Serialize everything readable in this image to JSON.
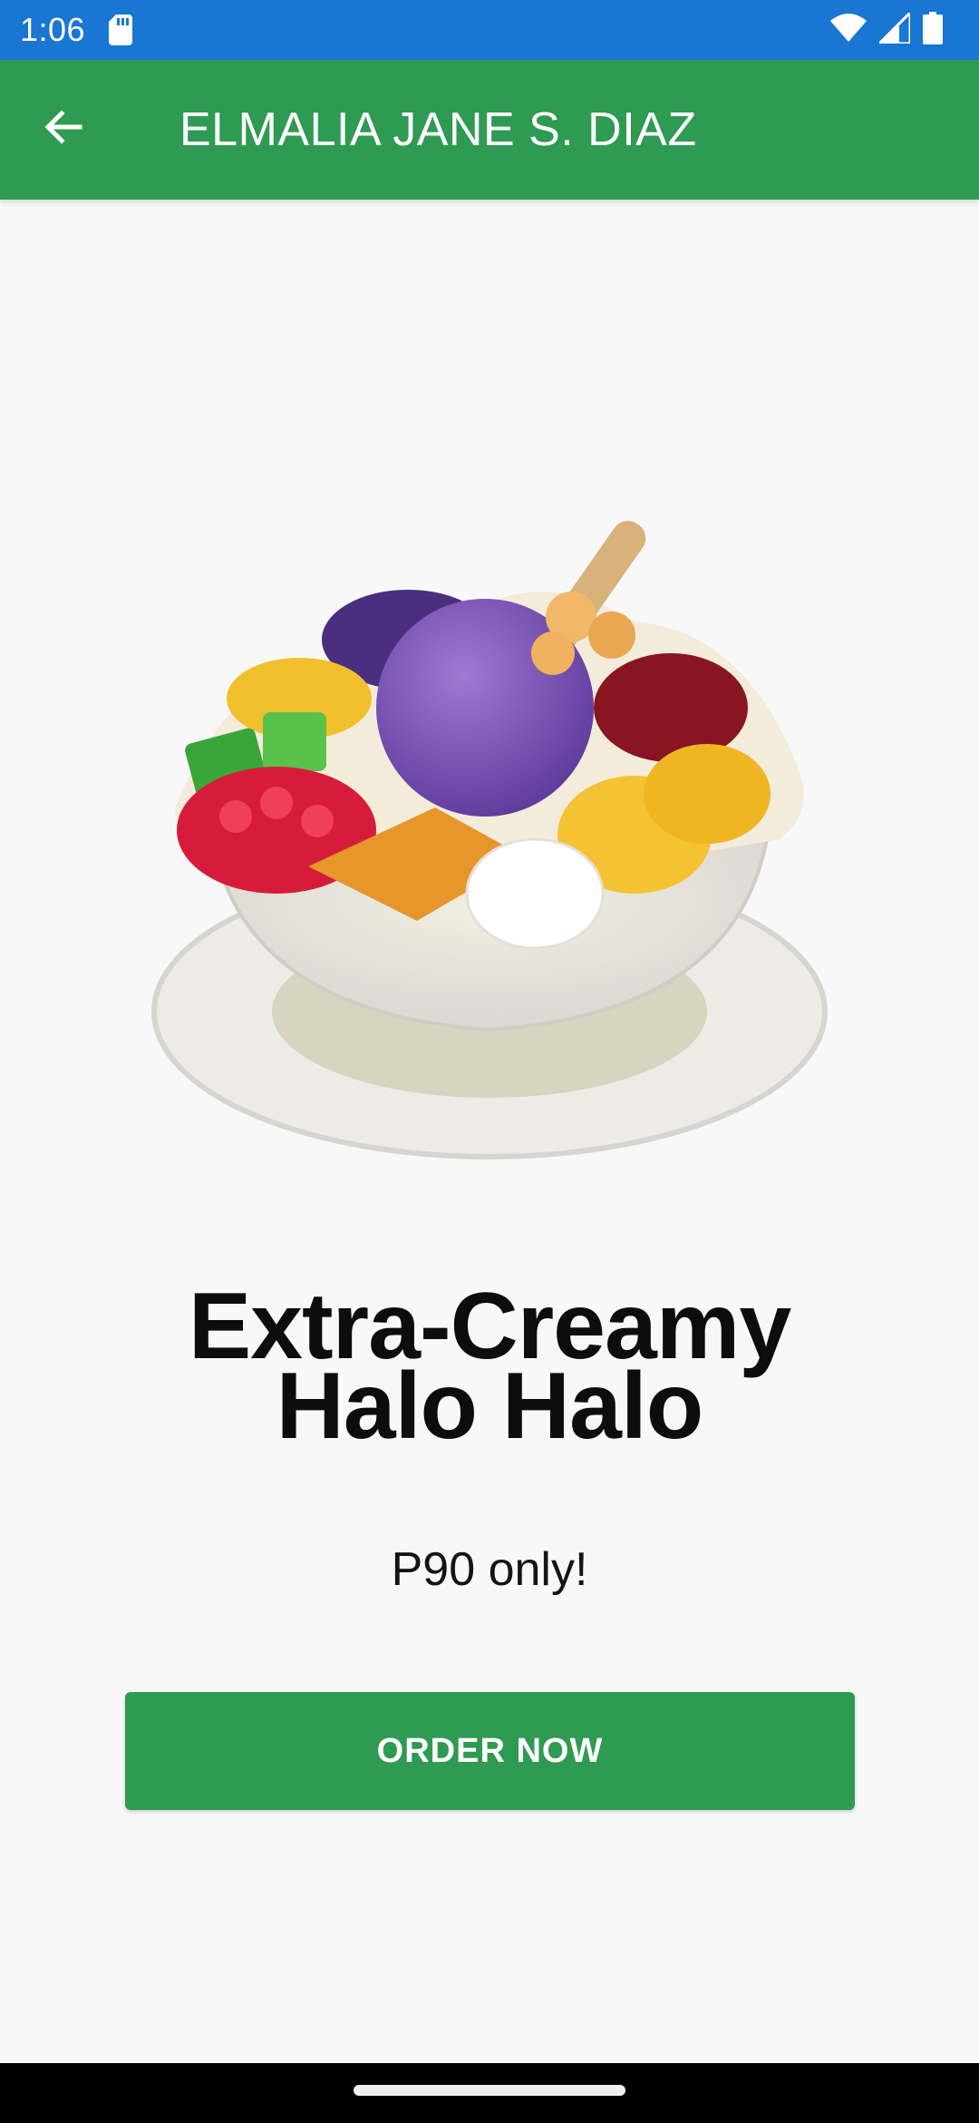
{
  "status_bar": {
    "time": "1:06",
    "icons": [
      "sd-card-icon",
      "wifi-icon",
      "signal-icon",
      "battery-icon"
    ]
  },
  "app_bar": {
    "back_icon": "arrow-left-icon",
    "title": "ELMALIA JANE S. DIAZ"
  },
  "product": {
    "image": "halo-halo-dessert-image",
    "title_line1": "Extra-Creamy",
    "title_line2": "Halo Halo",
    "price": "P90 only!"
  },
  "actions": {
    "order_label": "ORDER NOW"
  },
  "colors": {
    "status_bar": "#1976d2",
    "primary": "#2e9a52",
    "background": "#f8f8f8"
  }
}
